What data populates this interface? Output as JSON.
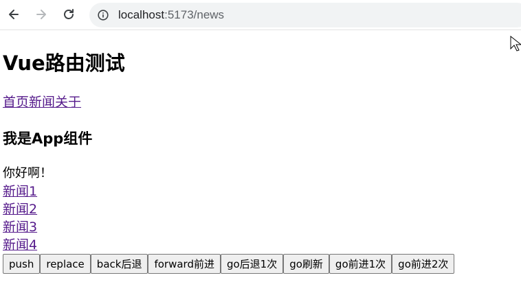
{
  "browser": {
    "url_host": "localhost",
    "url_path": ":5173/news",
    "icons": [
      "back-arrow-icon",
      "forward-arrow-icon",
      "reload-icon",
      "info-icon"
    ]
  },
  "page": {
    "title": "Vue路由测试",
    "nav_links": [
      "首页",
      "新闻",
      "关于"
    ],
    "component_heading": "我是App组件",
    "greeting": "你好啊！",
    "news_items": [
      "新闻1",
      "新闻2",
      "新闻3",
      "新闻4"
    ],
    "buttons": [
      "push",
      "replace",
      "back后退",
      "forward前进",
      "go后退1次",
      "go刷新",
      "go前进1次",
      "go前进2次"
    ]
  },
  "colors": {
    "visited_link": "#551a8b",
    "omnibox_bg": "#f1f3f4",
    "button_bg": "#efefef"
  }
}
